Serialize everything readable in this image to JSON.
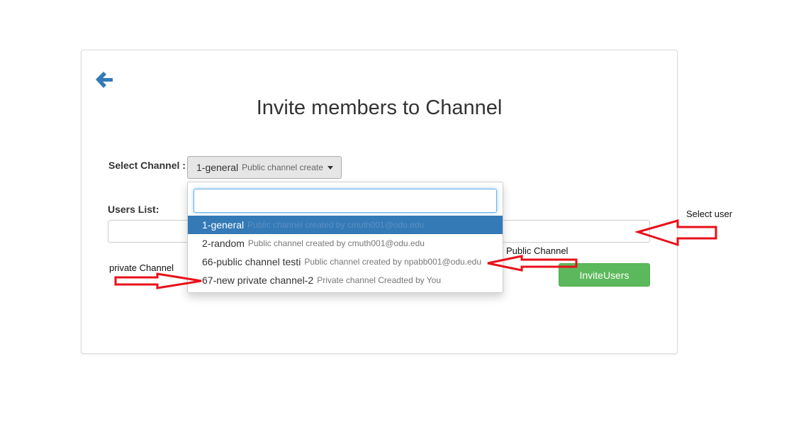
{
  "page": {
    "title": "Invite members to Channel"
  },
  "form": {
    "select_channel_label": "Select Channel :",
    "selected_channel_name": "1-general",
    "selected_channel_desc": "Public channel create",
    "users_list_label": "Users List:",
    "invite_button_label": "InviteUsers"
  },
  "dropdown": {
    "search_value": "",
    "items": [
      {
        "name": "1-general",
        "desc": "Public channel created by cmuth001@odu.edu",
        "active": true
      },
      {
        "name": "2-random",
        "desc": "Public channel created by cmuth001@odu.edu",
        "active": false
      },
      {
        "name": "66-public channel testi",
        "desc": "Public channel created by npabb001@odu.edu",
        "active": false
      },
      {
        "name": "67-new private channel-2",
        "desc": "Private channel Creadted by You",
        "active": false
      }
    ]
  },
  "annotations": {
    "select_user": "Select user",
    "public_channel": "Public Channel",
    "private_channel": "private Channel",
    "arrow_color": "#e8101a"
  },
  "colors": {
    "primary": "#337ab7",
    "success": "#5cb85c"
  }
}
